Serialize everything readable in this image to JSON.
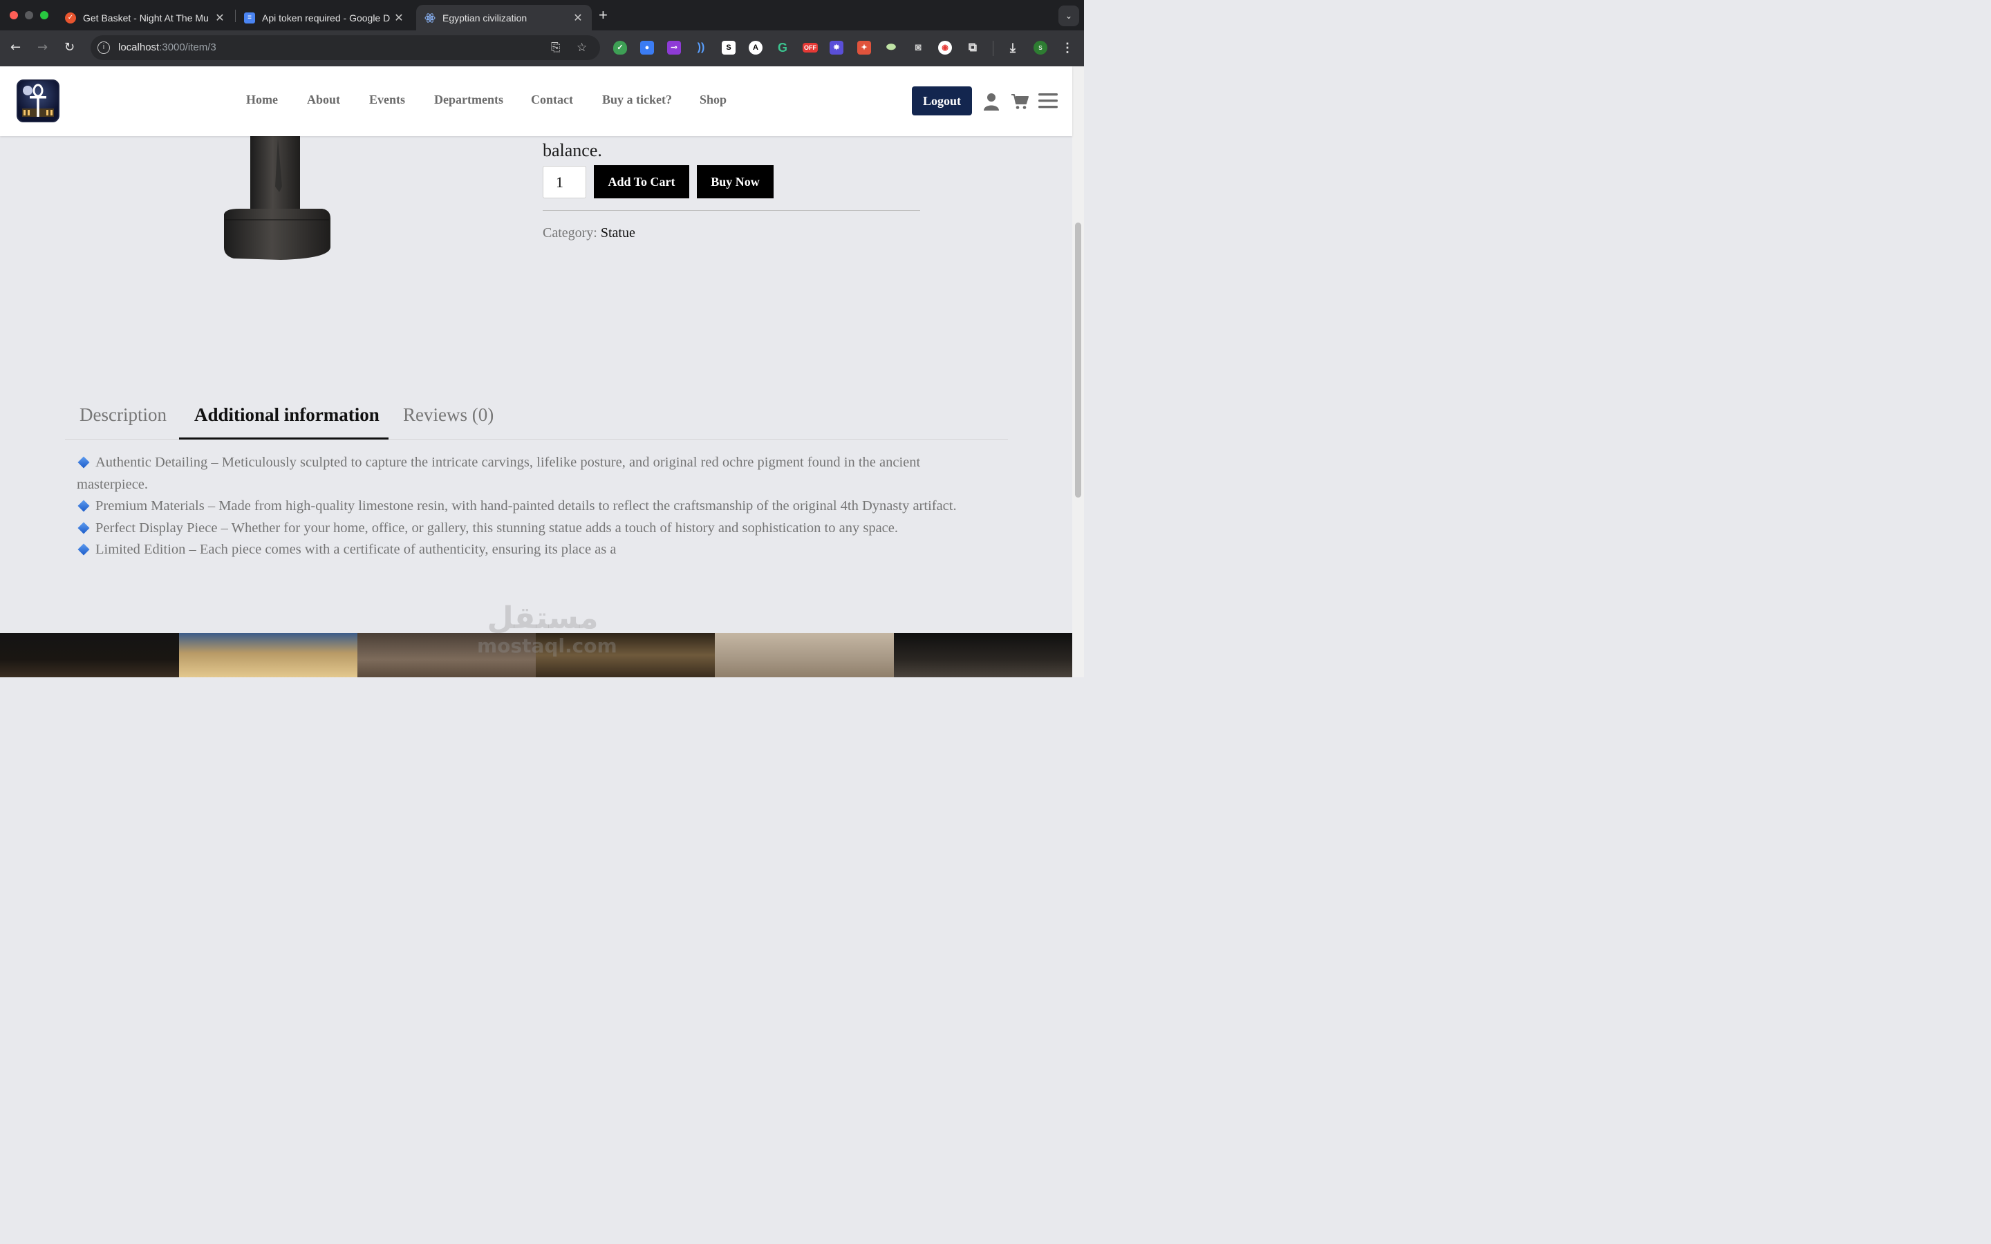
{
  "browser": {
    "tabs": [
      {
        "title": "Get Basket - Night At The Mu",
        "icon": "basket-favicon",
        "active": false
      },
      {
        "title": "Api token required - Google D",
        "icon": "google-docs-favicon",
        "active": false
      },
      {
        "title": "Egyptian civilization",
        "icon": "react-favicon",
        "active": true
      }
    ],
    "address": {
      "host": "localhost",
      "path": ":3000/item/3"
    },
    "extensions_badge": "OFF",
    "profile_initial": "s"
  },
  "site": {
    "nav": [
      "Home",
      "About",
      "Events",
      "Departments",
      "Contact",
      "Buy a ticket?",
      "Shop"
    ],
    "logout_label": "Logout"
  },
  "product": {
    "description_tail": "balance.",
    "quantity": "1",
    "add_to_cart_label": "Add To Cart",
    "buy_now_label": "Buy Now",
    "category_label": "Category:",
    "category_value": "Statue"
  },
  "tabs": {
    "description": "Description",
    "additional_info": "Additional information",
    "reviews": "Reviews (0)"
  },
  "additional_info": [
    "Authentic Detailing – Meticulously sculpted to capture the intricate carvings, lifelike posture, and original red ochre pigment found in the ancient masterpiece.",
    "Premium Materials – Made from high-quality limestone resin, with hand-painted details to reflect the craftsmanship of the original 4th Dynasty artifact.",
    "Perfect Display Piece – Whether for your home, office, or gallery, this stunning statue adds a touch of history and sophistication to any space.",
    "Limited Edition – Each piece comes with a certificate of authenticity, ensuring its place as a"
  ],
  "watermark": {
    "arabic": "مستقل",
    "latin": "mostaql.com"
  },
  "colors": {
    "accent_button": "#13264f",
    "page_bg": "#e8e9ed",
    "bullet": "#2f6fd8"
  }
}
